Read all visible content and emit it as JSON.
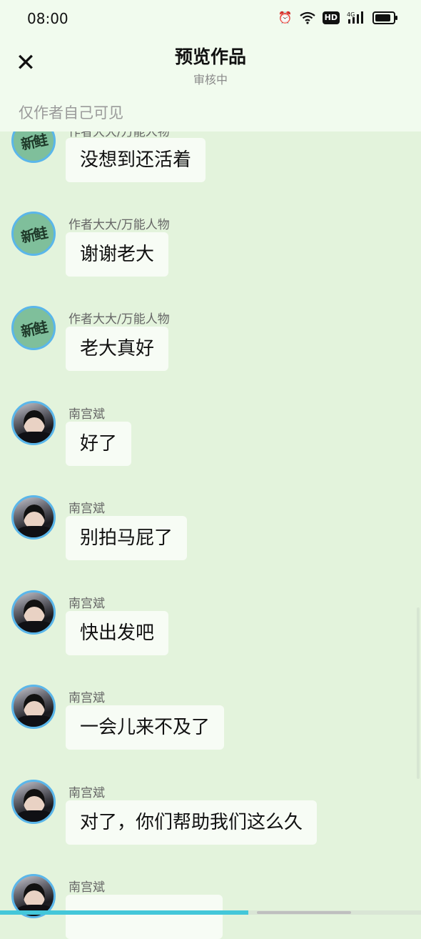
{
  "status": {
    "time": "08:00",
    "icons": [
      "alarm-icon",
      "wifi-icon",
      "hd-icon",
      "4g-signal-icon",
      "battery-icon"
    ]
  },
  "header": {
    "title": "预览作品",
    "subtitle": "审核中",
    "visibility": "仅作者自己可见"
  },
  "messages": [
    {
      "name": "作者大大/万能人物",
      "text": "没想到还活着",
      "avatar": "新鲑"
    },
    {
      "name": "作者大大/万能人物",
      "text": "谢谢老大",
      "avatar": "新鲑"
    },
    {
      "name": "作者大大/万能人物",
      "text": "老大真好",
      "avatar": "新鲑"
    },
    {
      "name": "南宫斌",
      "text": "好了"
    },
    {
      "name": "南宫斌",
      "text": "别拍马屁了"
    },
    {
      "name": "南宫斌",
      "text": "快出发吧"
    },
    {
      "name": "南宫斌",
      "text": "一会儿来不及了"
    },
    {
      "name": "南宫斌",
      "text": "对了，你们帮助我们这么久"
    },
    {
      "name": "南宫斌",
      "text": ""
    }
  ],
  "colors": {
    "background": "#e3f3dc",
    "bubble": "#f7fcf5",
    "avatar_border": "#5ab6ea"
  }
}
